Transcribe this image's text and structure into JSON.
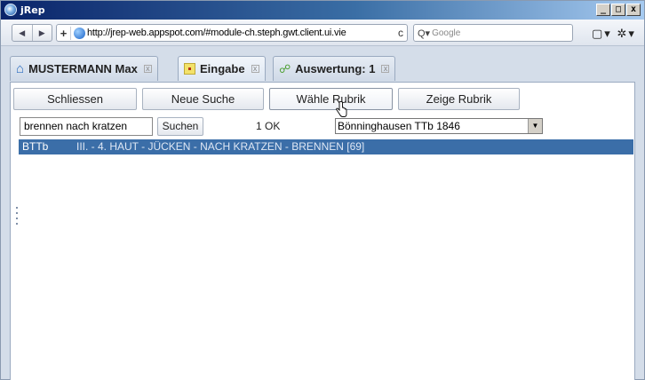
{
  "window": {
    "title": "jRep",
    "controls": [
      "_",
      "□",
      "x"
    ]
  },
  "navbar": {
    "back_label": "◀",
    "forward_label": "▶",
    "new_tab_label": "+",
    "url": "http://jrep-web.appspot.com/#module-ch.steph.gwt.client.ui.vie",
    "reload_label": "c",
    "search_placeholder": "Google",
    "search_icon_label": "Q▾",
    "page_menu_label": "▢▾",
    "tools_menu_label": "✲▾"
  },
  "tabs": [
    {
      "label": "MUSTERMANN Max",
      "icon": "home-icon",
      "active": false
    },
    {
      "label": "Eingabe",
      "icon": "note-icon",
      "active": true
    },
    {
      "label": "Auswertung: 1",
      "icon": "chart-icon",
      "active": false
    }
  ],
  "tab_close_label": "x",
  "toolbar": {
    "close_label": "Schliessen",
    "new_search_label": "Neue Suche",
    "choose_rubric_label": "Wähle Rubrik",
    "show_rubric_label": "Zeige Rubrik"
  },
  "search": {
    "value": "brennen nach kratzen",
    "button_label": "Suchen",
    "status": "1 OK",
    "repertory_selected": "Bönninghausen TTb 1846",
    "dropdown_arrow": "▼"
  },
  "results": [
    {
      "code": "BTTb",
      "text": "III. - 4. HAUT - JÜCKEN - NACH KRATZEN - BRENNEN  [69]"
    }
  ],
  "colors": {
    "selection": "#3b6ea8",
    "titlebar": "#0a246a"
  }
}
